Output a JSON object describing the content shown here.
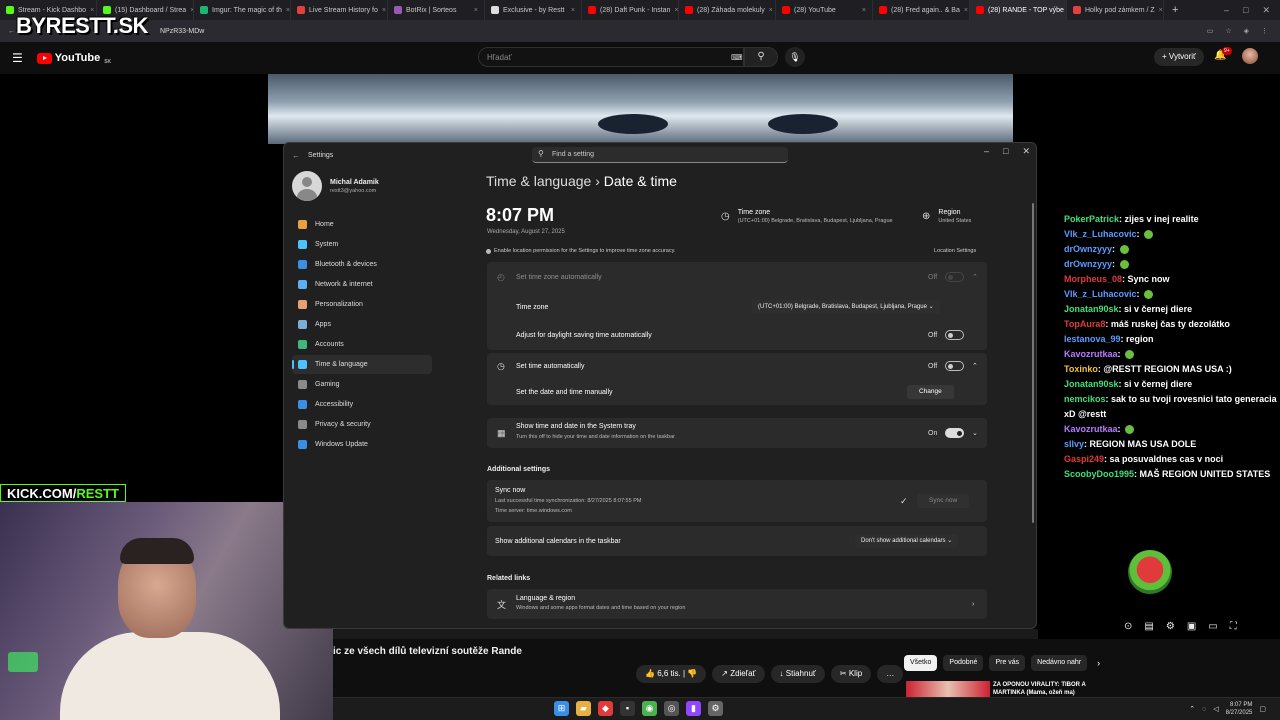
{
  "browser": {
    "tabs": [
      {
        "label": "Stream - Kick Dashbo",
        "color": "#53fc18"
      },
      {
        "label": "(15) Dashboard / Strea",
        "color": "#53fc18"
      },
      {
        "label": "Imgur: The magic of th",
        "color": "#1bb76e"
      },
      {
        "label": "Live Stream History fo",
        "color": "#e04040"
      },
      {
        "label": "BotRix | Sorteos",
        "color": "#9b59b6"
      },
      {
        "label": "Exclusive - by Restt",
        "color": "#dddddd"
      },
      {
        "label": "(28) Daft Punk - Instan",
        "color": "#ff0000"
      },
      {
        "label": "(28) Záhada molekuly",
        "color": "#ff0000"
      },
      {
        "label": "(28) YouTube",
        "color": "#ff0000"
      },
      {
        "label": "(28) Fred again.. & Ba",
        "color": "#ff0000"
      },
      {
        "label": "(28) RANDE - TOP výbe",
        "color": "#ff0000"
      },
      {
        "label": "Holky pod zámkem / Z",
        "color": "#e04040"
      }
    ],
    "active_tab": 10,
    "new_tab": "+",
    "url": "NPzR33-MDw"
  },
  "overlay": {
    "logo": "BYRESTT.SK",
    "kick": "KICK.COM/",
    "kick_user": "RESTT"
  },
  "youtube": {
    "brand": "YouTube",
    "country": "SK",
    "search_placeholder": "Hľadať",
    "create": "Vytvoriť",
    "notif_badge": "9+",
    "video_title": "ic ze všech dílů televizní soutěže Rande",
    "actions": {
      "likes": "6,6 tis.",
      "share": "Zdieľať",
      "download": "Stiahnuť",
      "clip": "Klip",
      "more": "…"
    },
    "chips": [
      "Všetko",
      "Podobné",
      "Pre vás",
      "Nedávno nahr"
    ],
    "rec_title": "ZA OPONOU VIRALITY: TIBOR A MARTINKA (Mama, ožeň ma)"
  },
  "settings": {
    "window_title": "Settings",
    "find_placeholder": "Find a setting",
    "user": {
      "name": "Michal Adamik",
      "email": "restt3@yahoo.com"
    },
    "nav": [
      {
        "label": "Home",
        "color": "#e8a040"
      },
      {
        "label": "System",
        "color": "#4cc2ff"
      },
      {
        "label": "Bluetooth & devices",
        "color": "#3a8ee6"
      },
      {
        "label": "Network & internet",
        "color": "#5ab0f0"
      },
      {
        "label": "Personalization",
        "color": "#e8a070"
      },
      {
        "label": "Apps",
        "color": "#7ab0d8"
      },
      {
        "label": "Accounts",
        "color": "#3fb87a"
      },
      {
        "label": "Time & language",
        "color": "#4cc2ff"
      },
      {
        "label": "Gaming",
        "color": "#8a8a8a"
      },
      {
        "label": "Accessibility",
        "color": "#3a8ee6"
      },
      {
        "label": "Privacy & security",
        "color": "#8a8a8a"
      },
      {
        "label": "Windows Update",
        "color": "#3a8ee6"
      }
    ],
    "active_nav": 7,
    "breadcrumb_parent": "Time & language",
    "breadcrumb_sep": "›",
    "breadcrumb_current": "Date & time",
    "time": "8:07 PM",
    "date": "Wednesday, August 27, 2025",
    "timezone_header": {
      "title": "Time zone",
      "value": "(UTC+01:00) Belgrade, Bratislava, Budapest, Ljubljana, Prague"
    },
    "region_header": {
      "title": "Region",
      "value": "United States"
    },
    "location_msg": "Enable location permission for the Settings to improve time zone accuracy.",
    "location_link": "Location Settings",
    "set_tz_auto": {
      "label": "Set time zone automatically",
      "state": "Off"
    },
    "time_zone": {
      "label": "Time zone",
      "value": "(UTC+01:00) Belgrade, Bratislava, Budapest, Ljubljana, Prague"
    },
    "dst": {
      "label": "Adjust for daylight saving time automatically",
      "state": "Off"
    },
    "set_time_auto": {
      "label": "Set time automatically",
      "state": "Off"
    },
    "manual": {
      "label": "Set the date and time manually",
      "button": "Change"
    },
    "tray": {
      "label": "Show time and date in the System tray",
      "desc": "Turn this off to hide your time and date information on the taskbar",
      "state": "On"
    },
    "additional_header": "Additional settings",
    "sync": {
      "label": "Sync now",
      "last": "Last successful time synchronization: 8/27/2025 8:07:55 PM",
      "server": "Time server: time.windows.com",
      "button": "Sync now"
    },
    "calendars": {
      "label": "Show additional calendars in the taskbar",
      "value": "Don't show additional calendars"
    },
    "related_header": "Related links",
    "lang_region": {
      "label": "Language & region",
      "desc": "Windows and some apps format dates and time based on your region"
    }
  },
  "chat": [
    {
      "user": "PokerPatrick",
      "color": "#3fe07a",
      "text": "zijes v inej realite"
    },
    {
      "user": "Vlk_z_Luhacovic",
      "color": "#5a9cff",
      "text": ""
    },
    {
      "user": "drOwnzyyy",
      "color": "#5a9cff",
      "text": ""
    },
    {
      "user": "drOwnzyyy",
      "color": "#5a9cff",
      "text": ""
    },
    {
      "user": "Morpheus_08",
      "color": "#e03a3a",
      "text": "Sync now"
    },
    {
      "user": "Vlk_z_Luhacovic",
      "color": "#5a9cff",
      "text": ""
    },
    {
      "user": "Jonatan90sk",
      "color": "#3fe07a",
      "text": "si v černej diere"
    },
    {
      "user": "TopAura8",
      "color": "#e03a3a",
      "text": "máš ruskej čas ty dezolátko"
    },
    {
      "user": "lestanova_99",
      "color": "#5a9cff",
      "text": "region"
    },
    {
      "user": "Kavozrutkaa",
      "color": "#b97aff",
      "text": ""
    },
    {
      "user": "Toxinko",
      "color": "#f0c040",
      "text": "@RESTT REGION MAS USA :)"
    },
    {
      "user": "Jonatan90sk",
      "color": "#3fe07a",
      "text": "si v černej diere"
    },
    {
      "user": "nemcikos",
      "color": "#3fe07a",
      "text": "sak to su tvoji rovesnici tato generacia xD @restt"
    },
    {
      "user": "Kavozrutkaa",
      "color": "#b97aff",
      "text": ""
    },
    {
      "user": "sllvy",
      "color": "#5a9cff",
      "text": "REGION MAS USA DOLE"
    },
    {
      "user": "Gaspi249",
      "color": "#e03a3a",
      "text": "sa posuvaldnes cas v noci"
    },
    {
      "user": "ScoobyDoo1995",
      "color": "#3fe07a",
      "text": "MAŠ REGION UNITED STATES"
    }
  ],
  "taskbar": {
    "time": "8:07 PM",
    "date": "8/27/2025"
  }
}
